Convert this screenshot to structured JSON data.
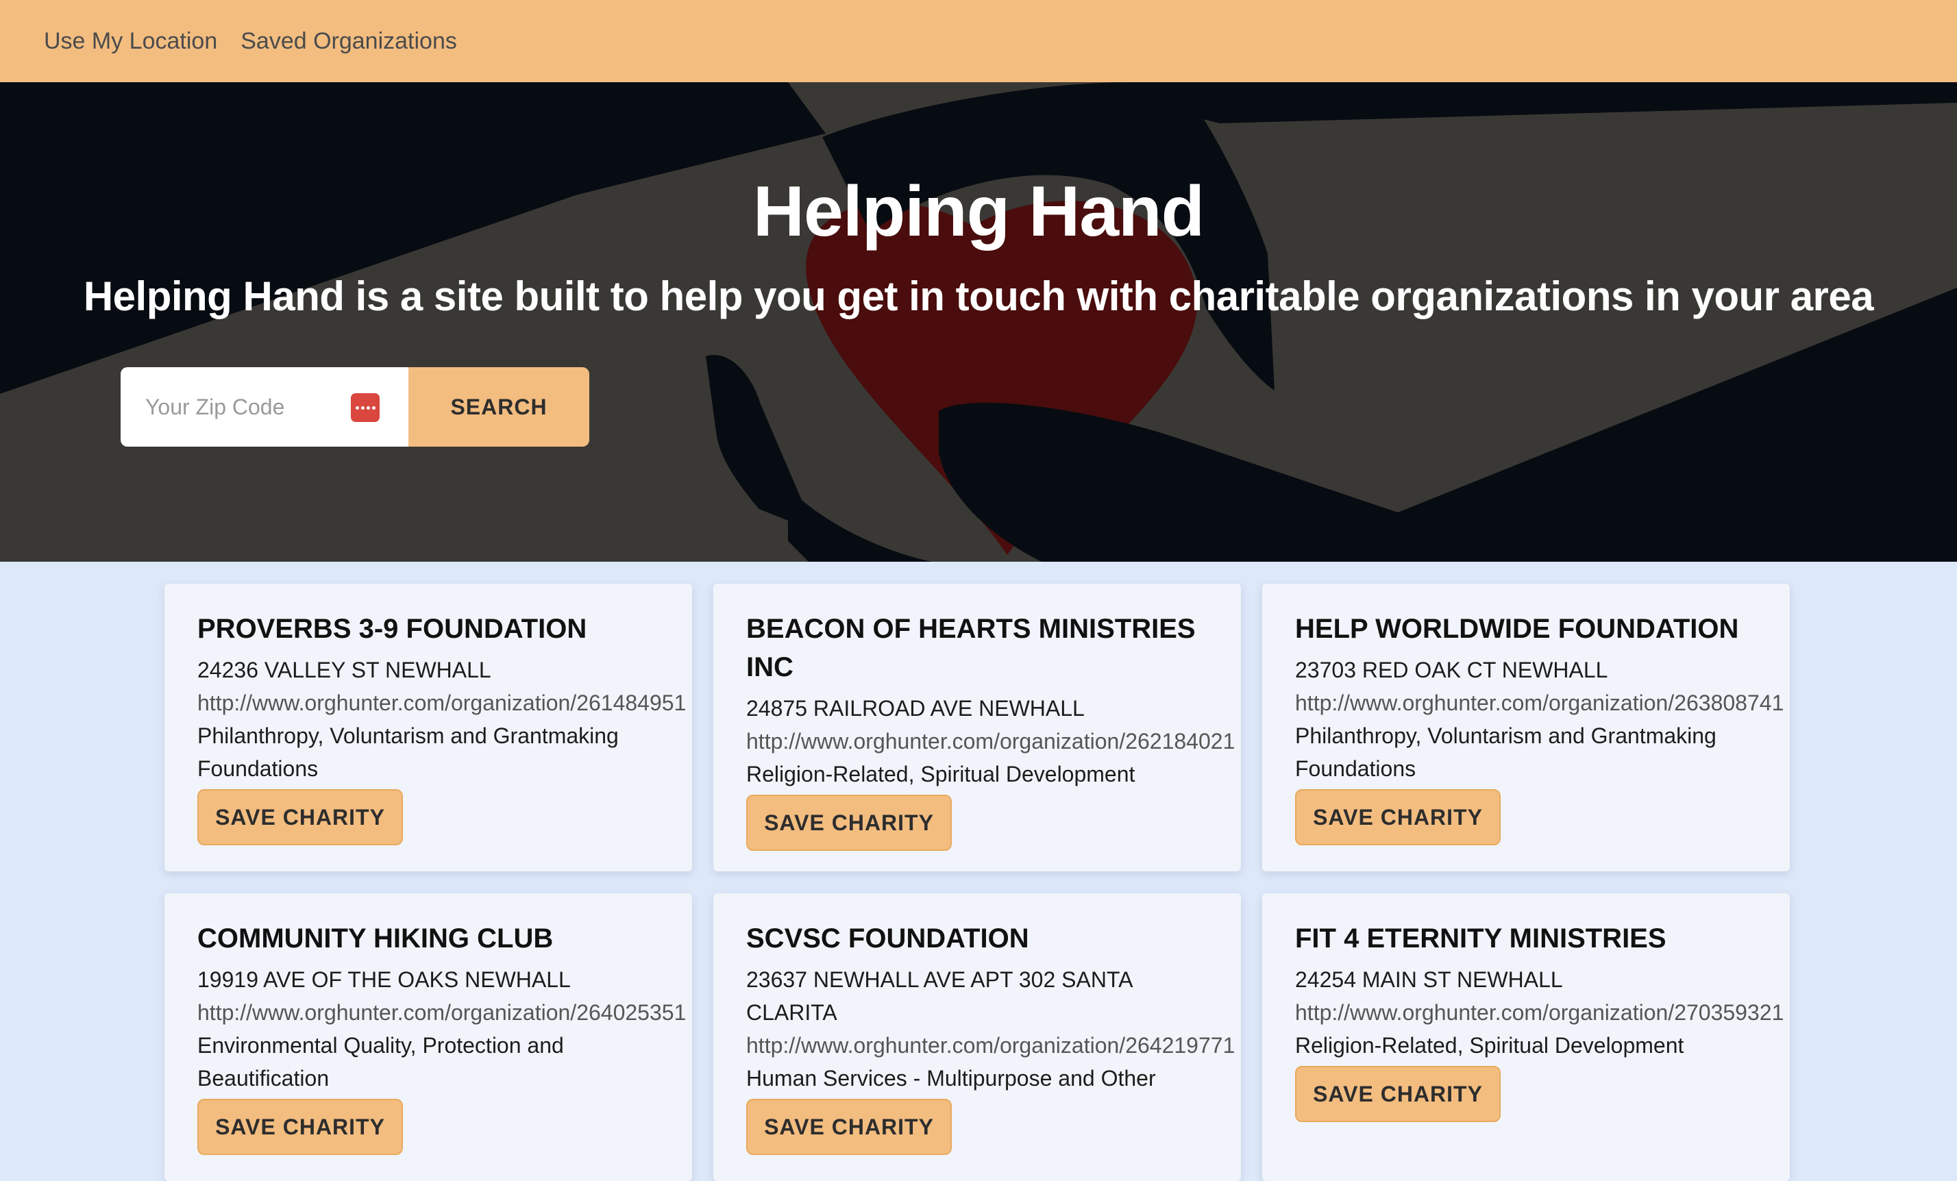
{
  "nav": {
    "location_link": "Use My Location",
    "saved_link": "Saved Organizations"
  },
  "hero": {
    "title": "Helping Hand",
    "subtitle": "Helping Hand is a site built to help you get in touch with charitable organizations in your area",
    "zip_placeholder": "Your Zip Code",
    "zip_value": "",
    "search_label": "SEARCH"
  },
  "cards": [
    {
      "name": "PROVERBS 3-9 FOUNDATION",
      "address": "24236 VALLEY ST NEWHALL",
      "url": "http://www.orghunter.com/organization/261484951",
      "category": "Philanthropy, Voluntarism and Grantmaking Foundations",
      "button": "SAVE CHARITY"
    },
    {
      "name": "BEACON OF HEARTS MINISTRIES INC",
      "address": "24875 RAILROAD AVE NEWHALL",
      "url": "http://www.orghunter.com/organization/262184021",
      "category": "Religion-Related, Spiritual Development",
      "button": "SAVE CHARITY"
    },
    {
      "name": "HELP WORLDWIDE FOUNDATION",
      "address": "23703 RED OAK CT NEWHALL",
      "url": "http://www.orghunter.com/organization/263808741",
      "category": "Philanthropy, Voluntarism and Grantmaking Foundations",
      "button": "SAVE CHARITY"
    },
    {
      "name": "COMMUNITY HIKING CLUB",
      "address": "19919 AVE OF THE OAKS NEWHALL",
      "url": "http://www.orghunter.com/organization/264025351",
      "category": "Environmental Quality, Protection and Beautification",
      "button": "SAVE CHARITY"
    },
    {
      "name": "SCVSC FOUNDATION",
      "address": "23637 NEWHALL AVE APT 302 SANTA CLARITA",
      "url": "http://www.orghunter.com/organization/264219771",
      "category": "Human Services - Multipurpose and Other",
      "button": "SAVE CHARITY"
    },
    {
      "name": "FIT 4 ETERNITY MINISTRIES",
      "address": "24254 MAIN ST NEWHALL",
      "url": "http://www.orghunter.com/organization/270359321",
      "category": "Religion-Related, Spiritual Development",
      "button": "SAVE CHARITY"
    }
  ],
  "colors": {
    "nav_bg": "#f3bd80",
    "accent": "#f3bd80",
    "page_bg": "#dde8f9",
    "card_bg": "#f1f4fa"
  }
}
